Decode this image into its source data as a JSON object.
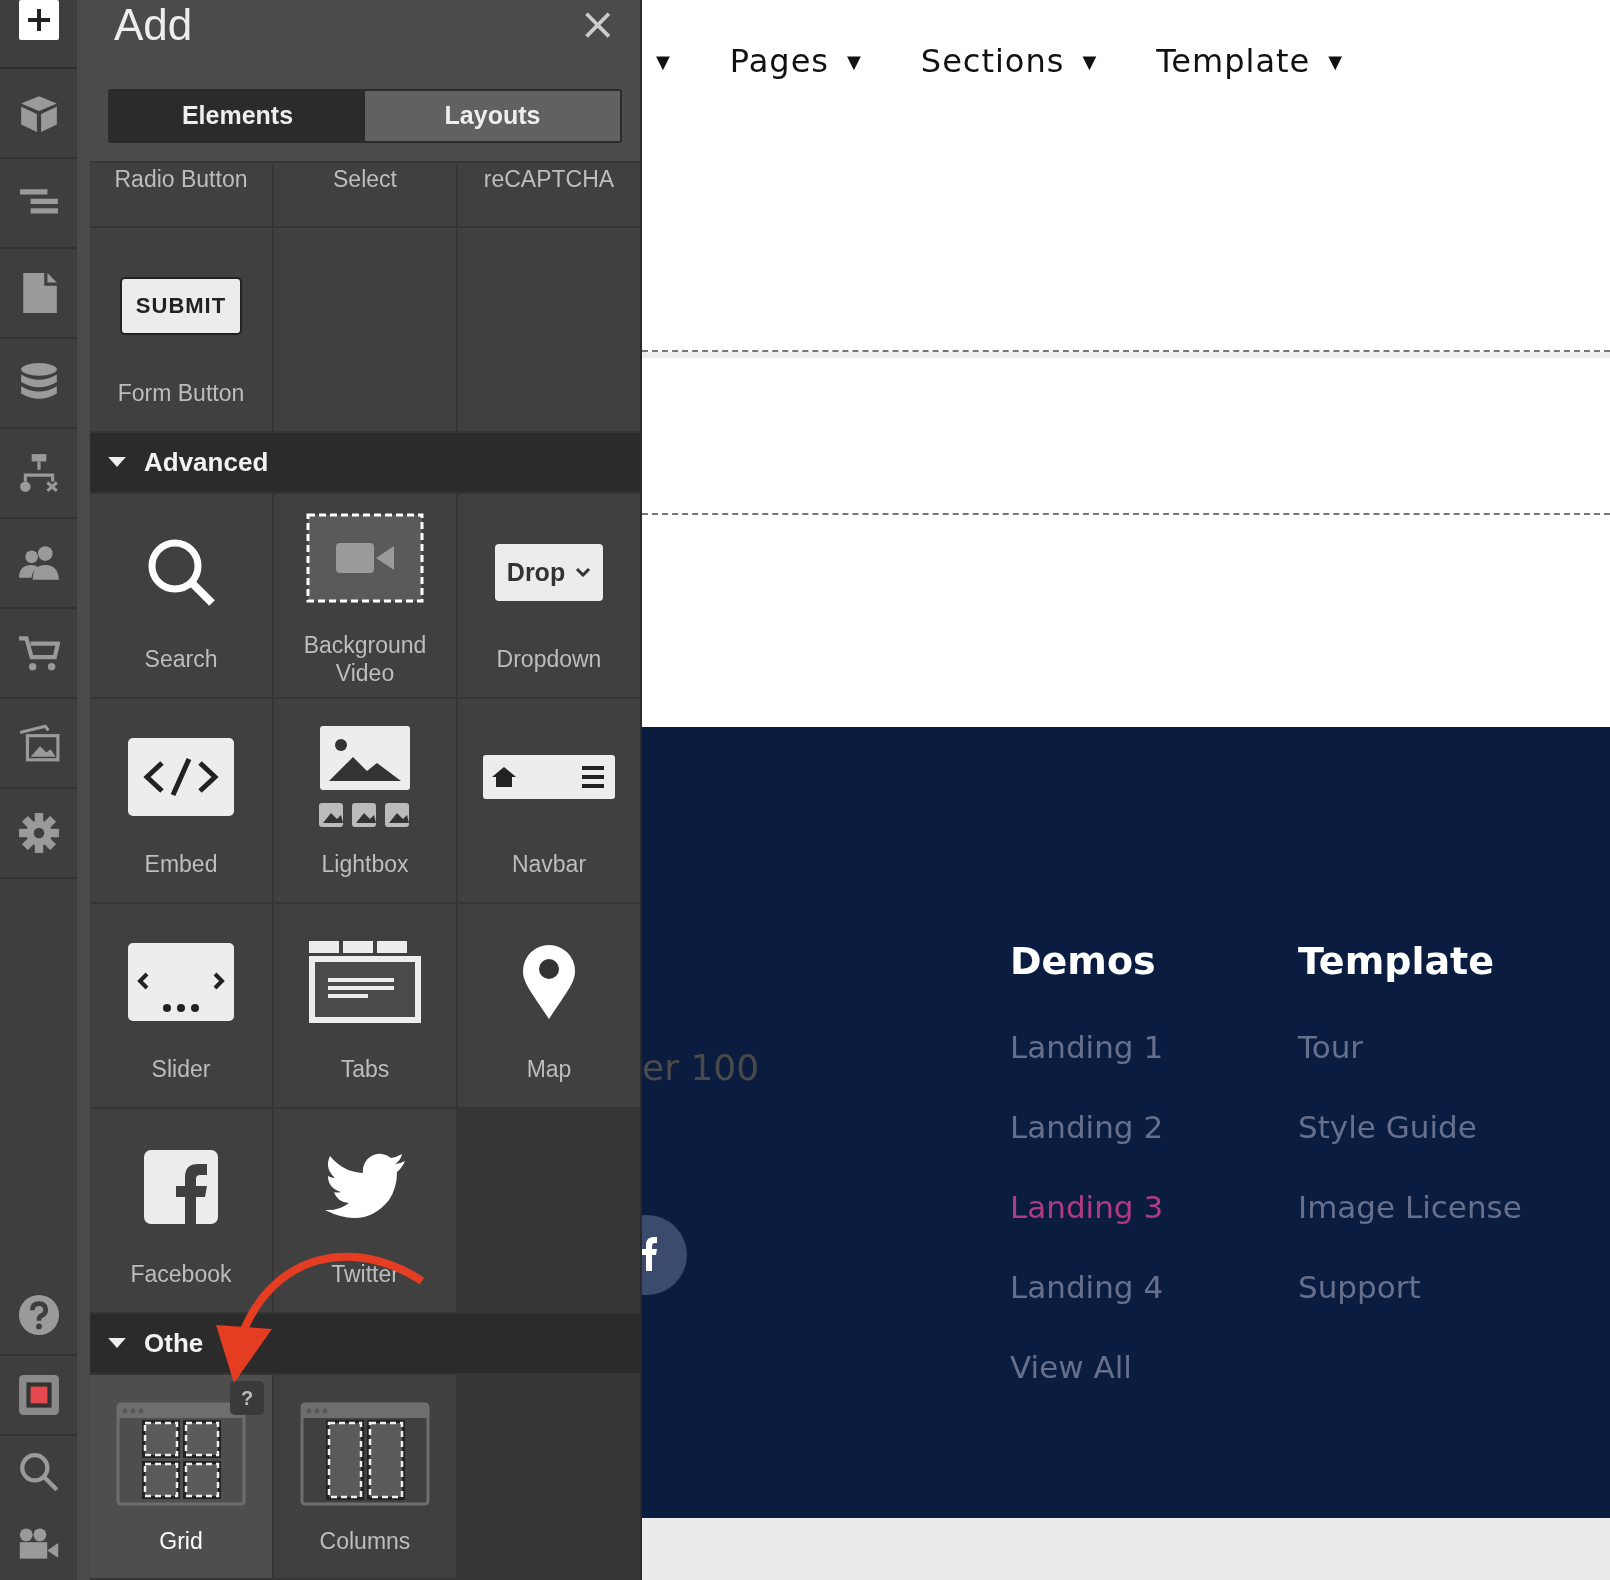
{
  "panel": {
    "title": "Add",
    "close": "×",
    "tabs": [
      {
        "label": "Elements",
        "selected": true
      },
      {
        "label": "Layouts",
        "selected": false
      }
    ],
    "partial_row": [
      "Radio Button",
      "Select",
      "reCAPTCHA"
    ],
    "form_items": [
      {
        "kind": "submit",
        "preview": "SUBMIT",
        "label": "Form Button"
      }
    ],
    "sections": [
      {
        "title": "Advanced",
        "expanded": true,
        "items": [
          {
            "kind": "search",
            "label": "Search",
            "selected": false
          },
          {
            "kind": "bgvideo",
            "label": "Background Video",
            "selected": false
          },
          {
            "kind": "dropdown",
            "label": "Dropdown",
            "preview": "Drop",
            "selected": false
          },
          {
            "kind": "embed",
            "label": "Embed",
            "selected": false
          },
          {
            "kind": "lightbox",
            "label": "Lightbox",
            "selected": false
          },
          {
            "kind": "navbar",
            "label": "Navbar",
            "selected": false
          },
          {
            "kind": "slider",
            "label": "Slider",
            "selected": false
          },
          {
            "kind": "tabs",
            "label": "Tabs",
            "selected": false
          },
          {
            "kind": "map",
            "label": "Map",
            "selected": false
          },
          {
            "kind": "facebook",
            "label": "Facebook",
            "selected": false
          },
          {
            "kind": "twitter",
            "label": "Twitter",
            "selected": false
          }
        ]
      },
      {
        "title": "Othe",
        "expanded": true,
        "items": [
          {
            "kind": "grid",
            "label": "Grid",
            "selected": true,
            "help": "?"
          },
          {
            "kind": "columns",
            "label": "Columns",
            "selected": false
          }
        ]
      }
    ]
  },
  "canvas": {
    "nav": [
      {
        "caret": "▼"
      },
      {
        "label": "Pages",
        "caret": "▼"
      },
      {
        "label": "Sections",
        "caret": "▼"
      },
      {
        "label": "Template",
        "caret": "▼"
      }
    ],
    "footer": {
      "partial_text": "er 100",
      "columns": [
        {
          "heading": "Demos",
          "links": [
            {
              "label": "Landing 1",
              "selected": false
            },
            {
              "label": "Landing 2",
              "selected": false
            },
            {
              "label": "Landing 3",
              "selected": true
            },
            {
              "label": "Landing 4",
              "selected": false
            },
            {
              "label": "View All",
              "selected": false
            }
          ]
        },
        {
          "heading": "Template",
          "links": [
            {
              "label": "Tour",
              "selected": false
            },
            {
              "label": "Style Guide",
              "selected": false
            },
            {
              "label": "Image License",
              "selected": false
            },
            {
              "label": "Support",
              "selected": false
            }
          ]
        }
      ]
    }
  }
}
